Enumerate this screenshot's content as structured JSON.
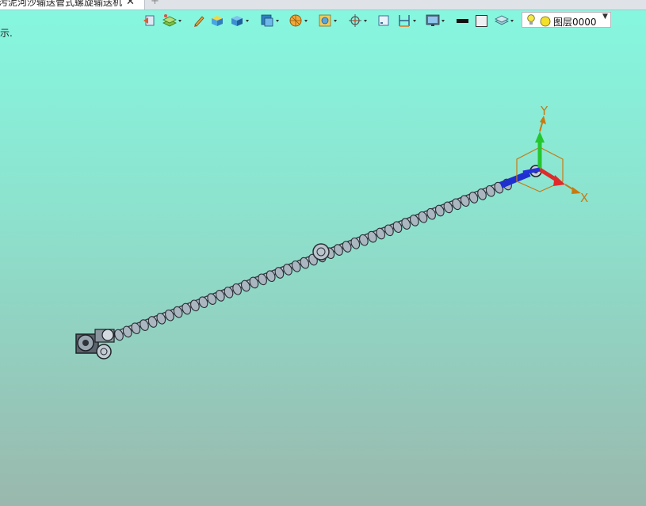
{
  "tabs": {
    "active_title": "污泥河沙输送管式螺旋输送机",
    "close_symbol": "✕",
    "add_symbol": "+"
  },
  "hint_text": "示.",
  "toolbar": {
    "items": [
      "view-back-icon",
      "layers-tool-icon",
      "pen-tool-icon",
      "box-view-icon",
      "shaded-cube-icon",
      "view-cube-icon",
      "render-style-icon",
      "section-icon",
      "snap-icon",
      "frame-icon",
      "dimension-icon",
      "monitor-icon",
      "line-color-icon",
      "fill-color-icon",
      "surface-icon"
    ]
  },
  "layer": {
    "name": "图层0000",
    "bulb_color": "#f4e84a",
    "dot_color": "#f2e02b"
  },
  "triad": {
    "x_label": "X",
    "y_label": "Y",
    "x_color": "#e02a2a",
    "y_color": "#24c72e",
    "z_color": "#2433d8",
    "label_color": "#c87a12"
  }
}
